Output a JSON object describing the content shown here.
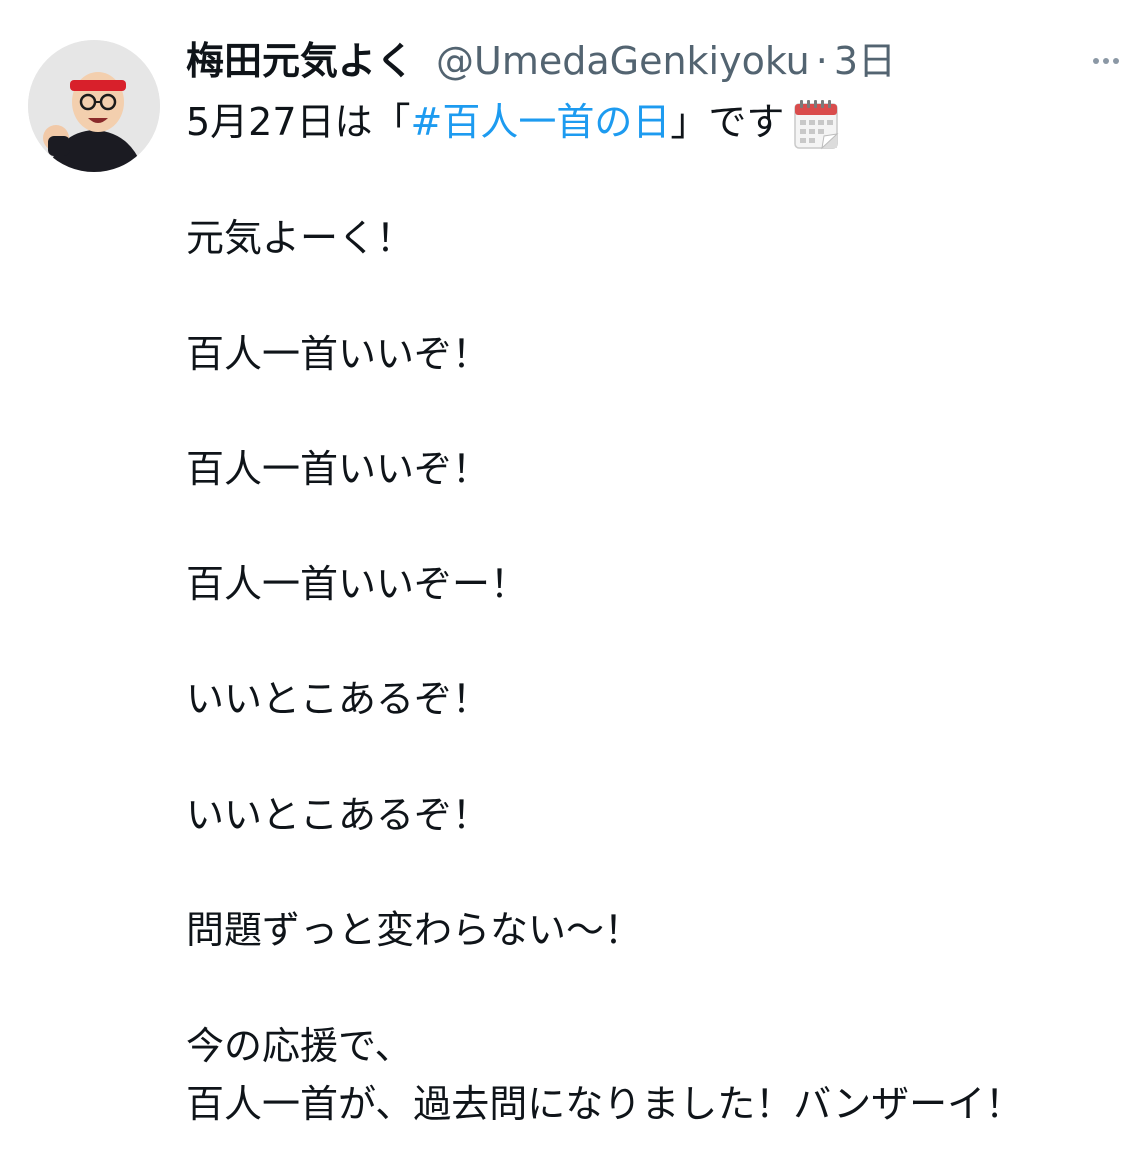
{
  "tweet": {
    "display_name": "梅田元気よく",
    "handle": "@UmedaGenkiyoku",
    "separator": "·",
    "time": "3日",
    "first_line": {
      "prefix": "5月27日は「",
      "hashtag": "#百人一首の日",
      "suffix": "」です"
    },
    "lines": [
      "元気よーく！",
      "百人一首いいぞ！",
      "百人一首いいぞ！",
      "百人一首いいぞー！",
      "いいとこあるぞ！",
      "いいとこあるぞ！",
      "問題ずっと変わらない〜！",
      "今の応援で、",
      "百人一首が、過去問になりました！バンザーイ！"
    ],
    "icons": {
      "avatar": "avatar-photo",
      "calendar": "calendar-icon",
      "more": "more-options-icon"
    },
    "colors": {
      "hashtag": "#1d9bf0",
      "secondary_text": "#536471",
      "primary_text": "#0f1419"
    }
  }
}
